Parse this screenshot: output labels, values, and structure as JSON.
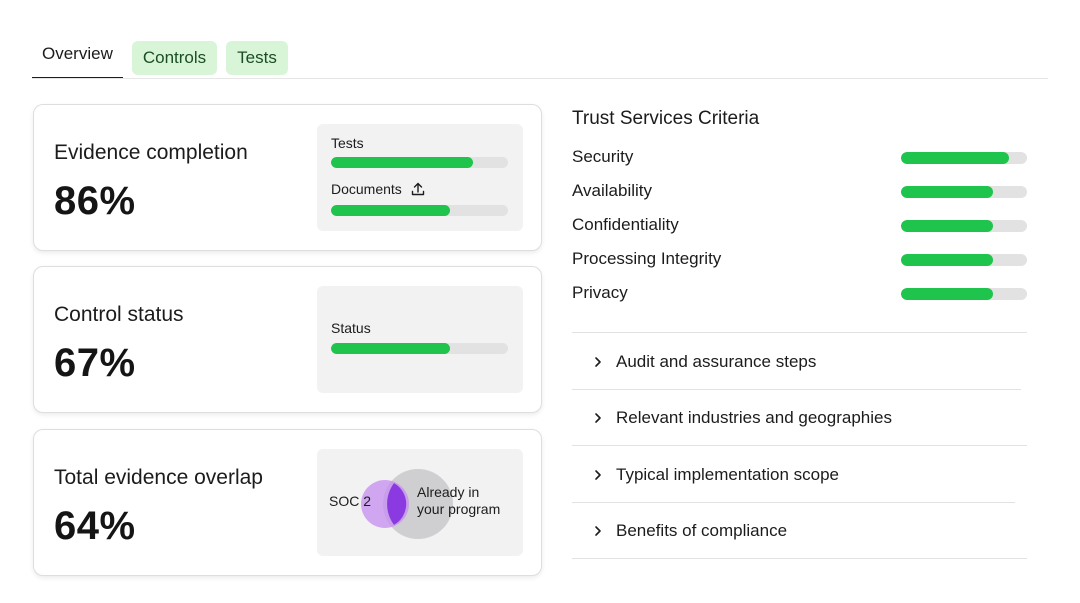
{
  "tabs": [
    {
      "label": "Overview",
      "active": true
    },
    {
      "label": "Controls",
      "active": false
    },
    {
      "label": "Tests",
      "active": false
    }
  ],
  "cards": {
    "evidence": {
      "title": "Evidence completion",
      "value": "86%",
      "bars": [
        {
          "label": "Tests",
          "progress": 0.8
        },
        {
          "label": "Documents",
          "progress": 0.67,
          "icon": "upload-icon"
        }
      ]
    },
    "control": {
      "title": "Control status",
      "value": "67%",
      "bars": [
        {
          "label": "Status",
          "progress": 0.67
        }
      ]
    },
    "overlap": {
      "title": "Total evidence overlap",
      "value": "64%",
      "venn": {
        "left_label": "SOC 2",
        "right_label_line1": "Already in",
        "right_label_line2": "your program"
      }
    }
  },
  "tsc": {
    "title": "Trust Services Criteria",
    "criteria": [
      {
        "label": "Security",
        "progress": 0.86
      },
      {
        "label": "Availability",
        "progress": 0.73
      },
      {
        "label": "Confidentiality",
        "progress": 0.73
      },
      {
        "label": "Processing Integrity",
        "progress": 0.73
      },
      {
        "label": "Privacy",
        "progress": 0.73
      }
    ]
  },
  "accordion": [
    {
      "label": "Audit and assurance steps",
      "icon": "chevron-right-icon"
    },
    {
      "label": "Relevant industries and geographies",
      "icon": "chevron-right-icon"
    },
    {
      "label": "Typical implementation scope",
      "icon": "chevron-right-icon"
    },
    {
      "label": "Benefits of compliance",
      "icon": "chevron-right-icon"
    }
  ],
  "colors": {
    "accent_green": "#1ec44b",
    "tab_pill_bg": "#d8f5d8",
    "venn_purple": "#8a3ae0",
    "venn_light_purple": "#c58cf0",
    "venn_gray": "#c4c4c4"
  }
}
